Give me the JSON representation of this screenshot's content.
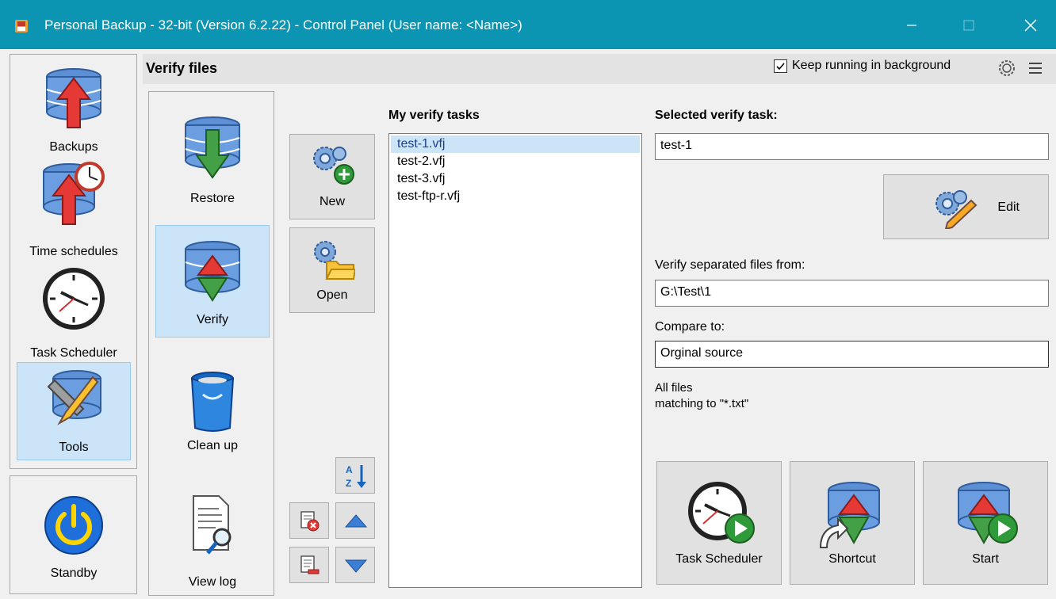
{
  "window": {
    "title": "Personal Backup - 32-bit (Version 6.2.22) - Control Panel (User name: <Name>)"
  },
  "nav": {
    "items": [
      {
        "label": "Backups",
        "icon": "backup-database-icon"
      },
      {
        "label": "Time schedules",
        "icon": "time-schedule-icon"
      },
      {
        "label": "Task Scheduler",
        "icon": "clock-icon"
      },
      {
        "label": "Tools",
        "icon": "tools-icon"
      }
    ],
    "standby_label": "Standby"
  },
  "header": {
    "title": "Verify files",
    "keep_running_label": "Keep running in background",
    "keep_running_checked": true
  },
  "tools": {
    "items": [
      {
        "label": "Restore"
      },
      {
        "label": "Verify"
      },
      {
        "label": "Clean up"
      },
      {
        "label": "View log"
      }
    ]
  },
  "actions": {
    "new_label": "New",
    "open_label": "Open"
  },
  "task_list": {
    "title": "My verify tasks",
    "items": [
      "test-1.vfj",
      "test-2.vfj",
      "test-3.vfj",
      "test-ftp-r.vfj"
    ],
    "selected_index": 0
  },
  "selected_task": {
    "title": "Selected verify task:",
    "name": "test-1",
    "edit_label": "Edit",
    "source_label": "Verify separated files from:",
    "source_value": "G:\\Test\\1",
    "compare_label": "Compare to:",
    "compare_value": "Orginal source",
    "info_line1": "All files",
    "info_line2": "matching to \"*.txt\""
  },
  "bottom_buttons": {
    "task_scheduler_label": "Task Scheduler",
    "shortcut_label": "Shortcut",
    "start_label": "Start"
  },
  "colors": {
    "titlebar": "#0b95b3",
    "selection": "#cce4f7",
    "selection_border": "#99c9ef"
  }
}
